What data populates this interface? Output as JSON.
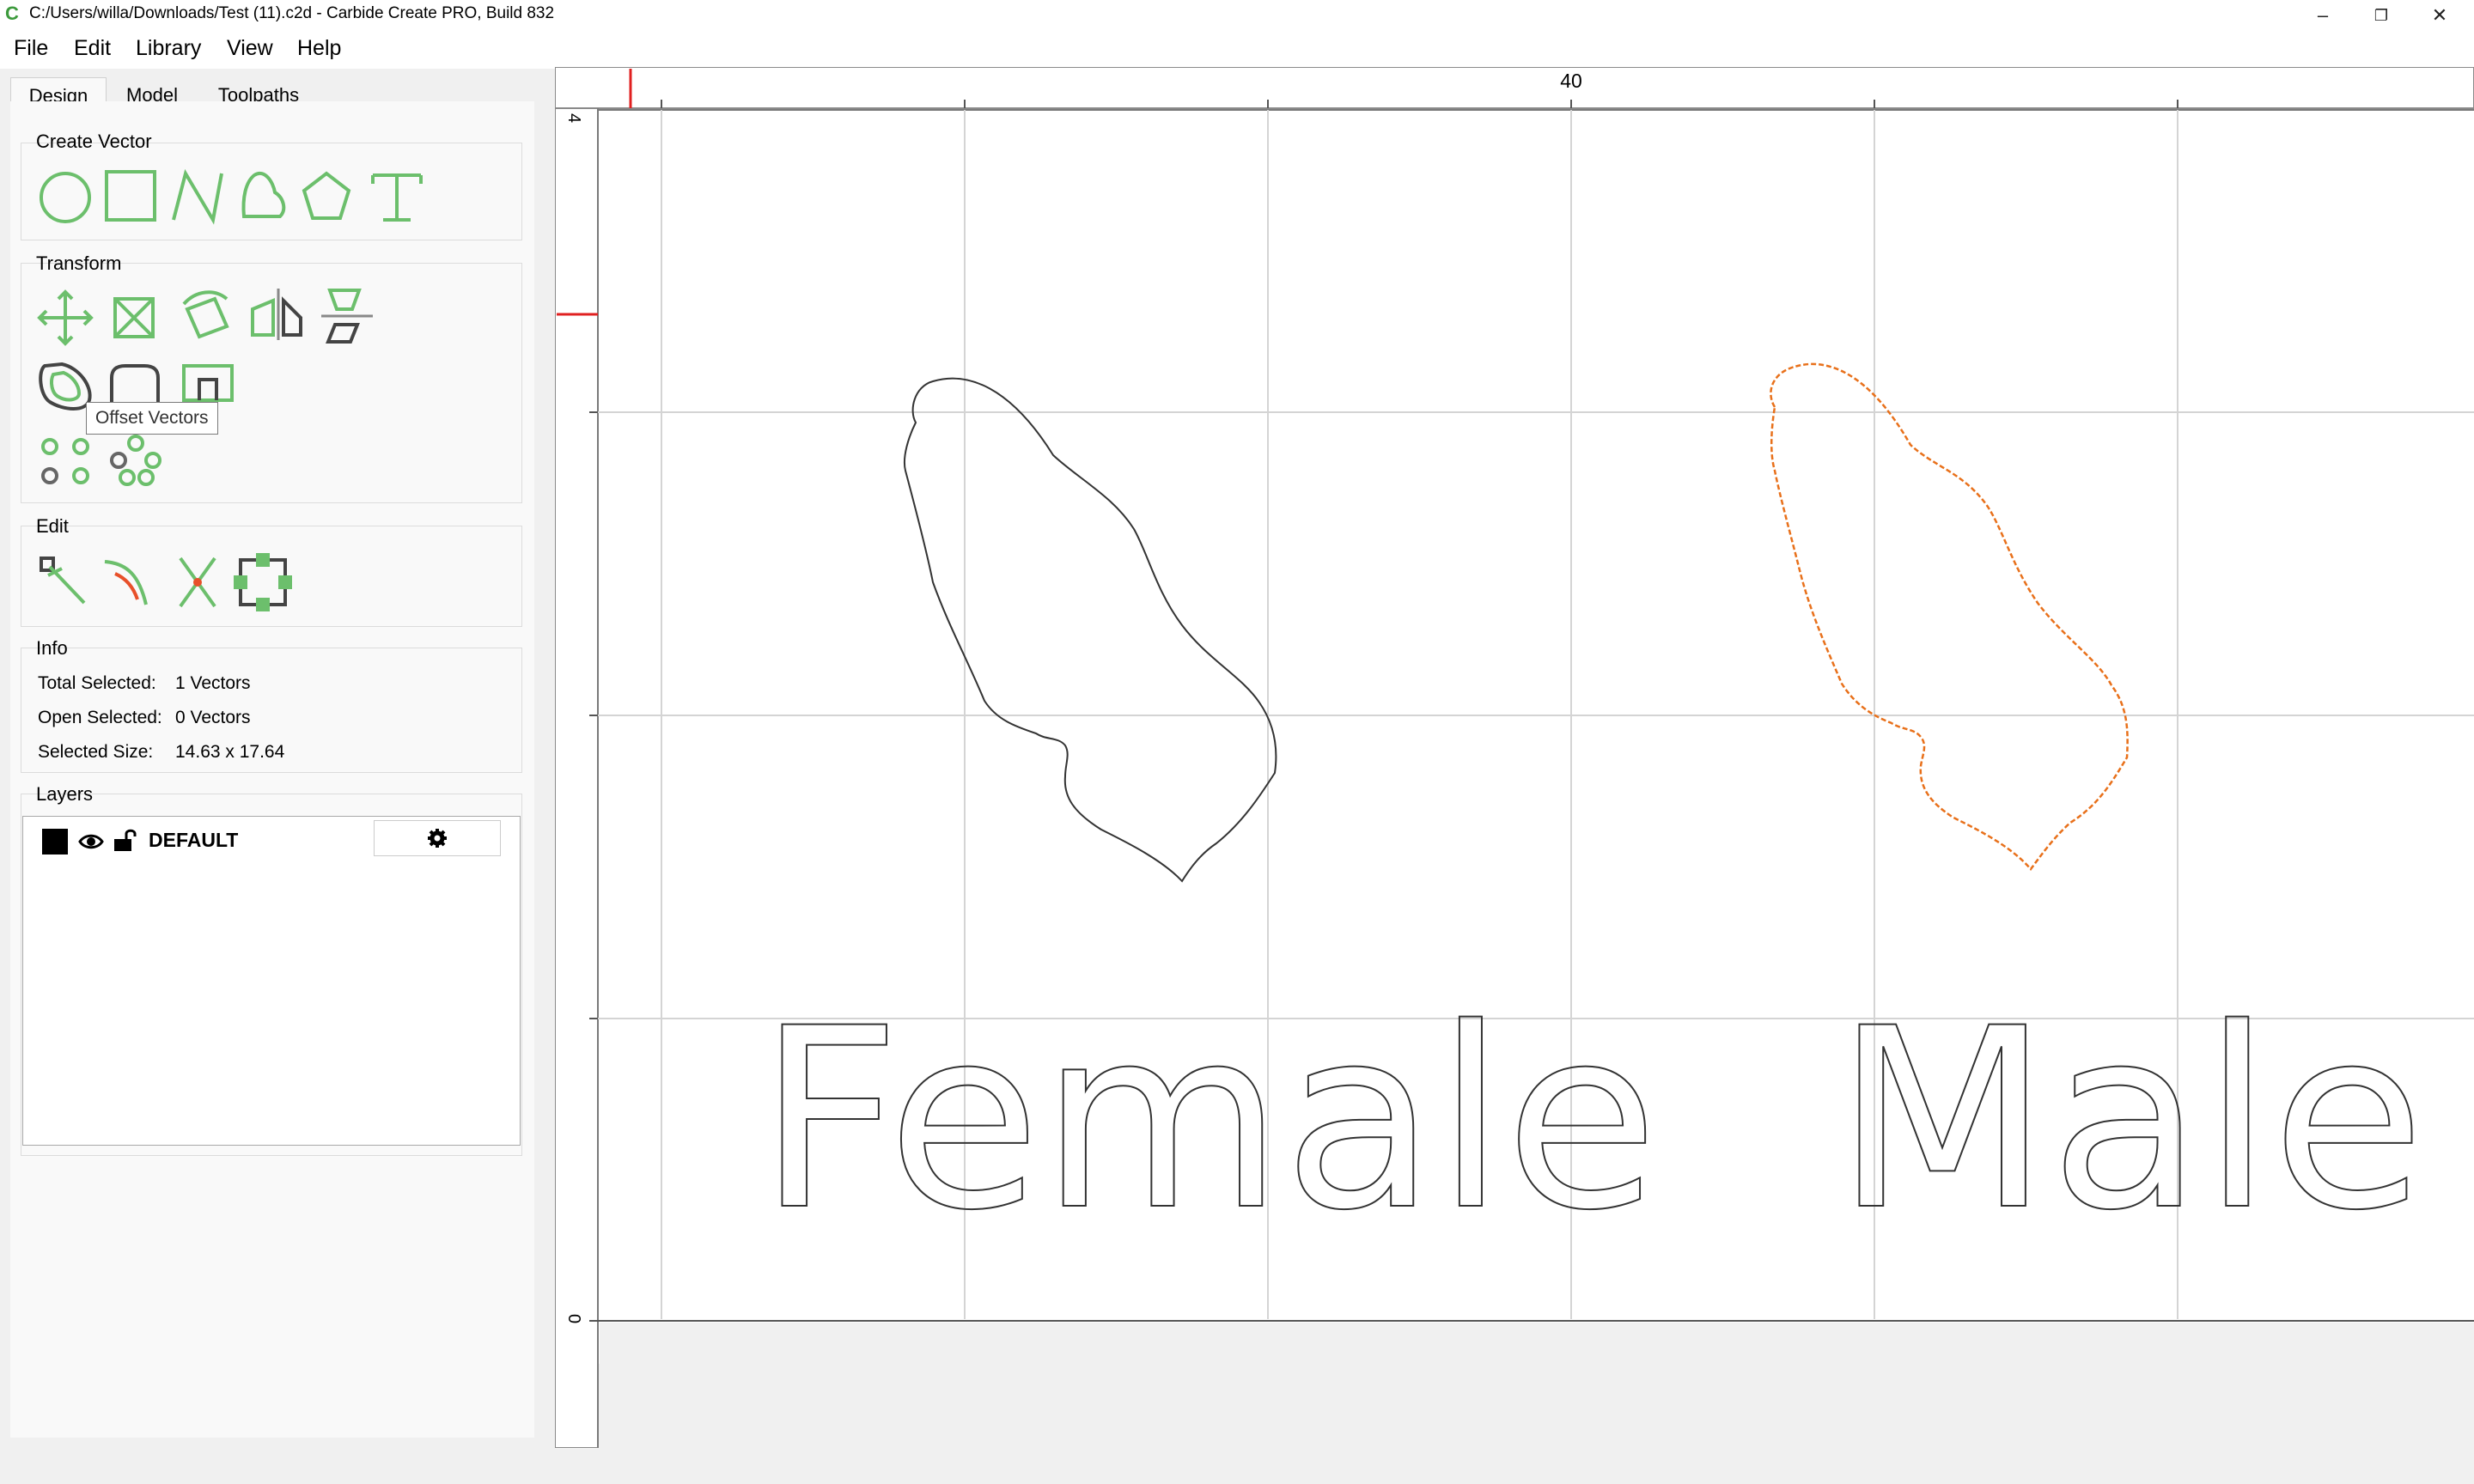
{
  "window": {
    "title": "C:/Users/willa/Downloads/Test (11).c2d - Carbide Create PRO, Build 832",
    "minimize_glyph": "–",
    "restore_glyph": "❐",
    "close_glyph": "✕"
  },
  "menu": [
    "File",
    "Edit",
    "Library",
    "View",
    "Help"
  ],
  "tabs": [
    "Design",
    "Model",
    "Toolpaths"
  ],
  "groups": {
    "create_vector": "Create Vector",
    "transform": "Transform",
    "edit": "Edit",
    "info": "Info",
    "layers": "Layers"
  },
  "create_vector_tools": [
    "circle-icon",
    "rectangle-icon",
    "polyline-icon",
    "curve-icon",
    "polygon-icon",
    "text-icon"
  ],
  "tooltip": "Offset Vectors",
  "info": {
    "total_selected_label": "Total Selected:",
    "total_selected_value": "1 Vectors",
    "open_selected_label": "Open Selected:",
    "open_selected_value": "0 Vectors",
    "selected_size_label": "Selected Size:",
    "selected_size_value": "14.63 x 17.64"
  },
  "layers": [
    {
      "name": "DEFAULT",
      "color": "#000000",
      "visible": true,
      "locked": false
    }
  ],
  "canvas": {
    "ruler_top_label": "40",
    "ruler_left_top_label": "4",
    "ruler_left_zero_label": "0",
    "text_left": "Female",
    "text_right": "Male",
    "selected_color": "#e8701a",
    "accent_green": "#6cbf6c",
    "marker_red": "#e02020"
  }
}
